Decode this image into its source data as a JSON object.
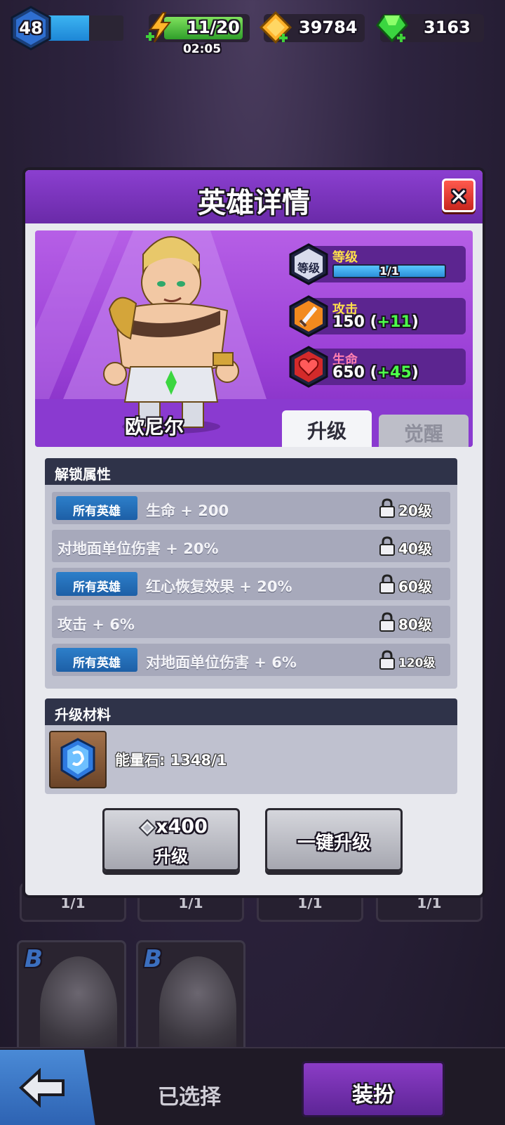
{
  "topbar": {
    "player_level": "48",
    "xp_progress": 0.55,
    "energy": "11/20",
    "energy_timer": "02:05",
    "gold": "39784",
    "gems": "3163"
  },
  "background": {
    "slots": [
      "1/1",
      "1/1",
      "1/1",
      "1/1"
    ],
    "hero_cards": [
      {
        "grade": "B",
        "icon": "knight-portrait"
      },
      {
        "grade": "B",
        "icon": "hero-portrait"
      }
    ],
    "selected_label": "已选择",
    "dress_label": "装扮"
  },
  "modal": {
    "title": "英雄详情",
    "hero_name": "欧尼尔",
    "level_label": "等级",
    "level_badge": "等级",
    "level_value": "1/1",
    "attack_label": "攻击",
    "attack_value": "150",
    "attack_bonus": "+11",
    "hp_label": "生命",
    "hp_value": "650",
    "hp_bonus": "+45",
    "tabs": {
      "upgrade": "升级",
      "awaken": "觉醒"
    },
    "unlock_title": "解锁属性",
    "unlock_rows": [
      {
        "tag": "所有英雄",
        "text": "生命 + 200",
        "req": "20级"
      },
      {
        "tag": "",
        "text": "对地面单位伤害 + 20%",
        "req": "40级"
      },
      {
        "tag": "所有英雄",
        "text": "红心恢复效果 + 20%",
        "req": "60级"
      },
      {
        "tag": "",
        "text": "攻击 + 6%",
        "req": "80级"
      },
      {
        "tag": "所有英雄",
        "text": "对地面单位伤害 + 6%",
        "req": "120级"
      }
    ],
    "materials_title": "升级材料",
    "material_text": "能量石: 1348/1",
    "upgrade_cost": "x400",
    "upgrade_label": "升级",
    "one_key_label": "一键升级"
  },
  "colors": {
    "header_purple": "#7a33bc",
    "accent_blue": "#2d7fca",
    "bonus_green": "#4dff4a",
    "attack_label": "#ffe14a",
    "hp_label": "#ff7fb0"
  }
}
